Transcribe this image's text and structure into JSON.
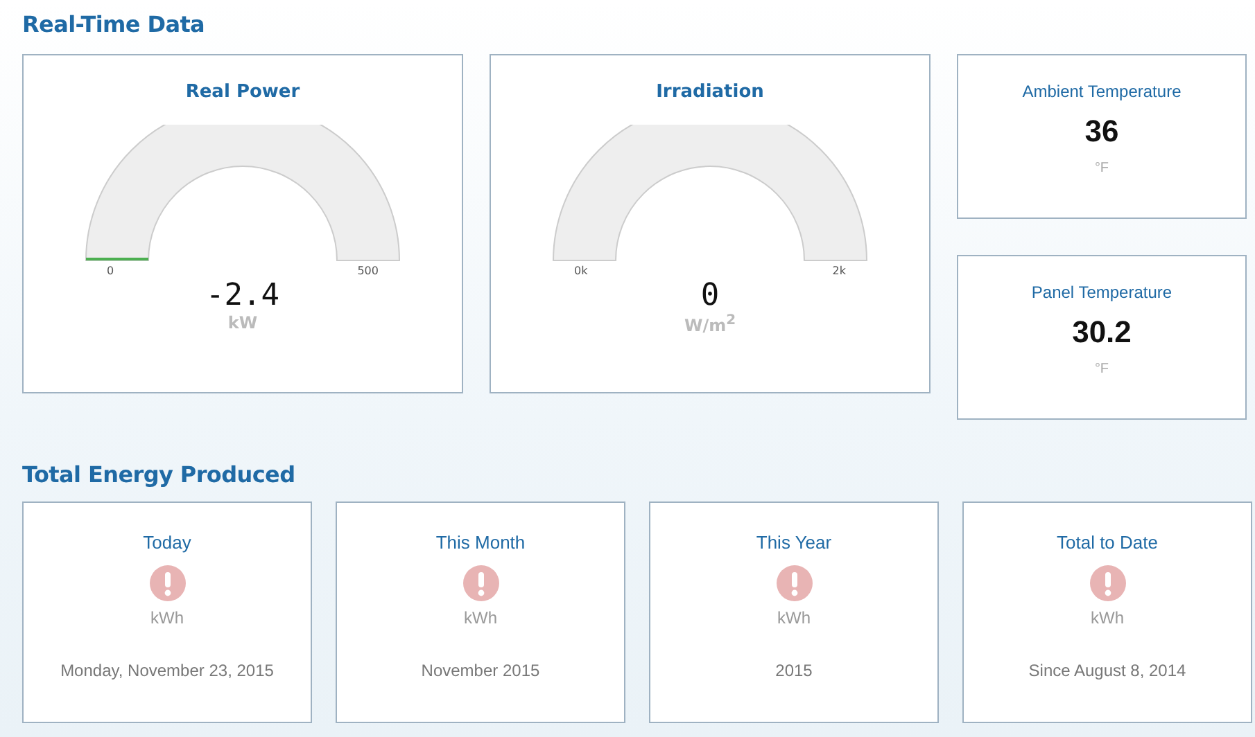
{
  "realtime": {
    "heading": "Real-Time Data",
    "gauges": [
      {
        "title": "Real Power",
        "min_label": "0",
        "max_label": "500",
        "value": "-2.4",
        "unit": "kW",
        "below_min": true
      },
      {
        "title": "Irradiation",
        "min_label": "0k",
        "max_label": "2k",
        "value": "0",
        "unit": "W/m$^{2}$",
        "below_min": false
      }
    ],
    "stats": [
      {
        "title": "Ambient Temperature",
        "value": "36",
        "unit": "°F"
      },
      {
        "title": "Panel Temperature",
        "value": "30.2",
        "unit": "°F"
      }
    ]
  },
  "energy": {
    "heading": "Total Energy Produced",
    "cards": [
      {
        "title": "Today",
        "alert": true,
        "unit": "kWh",
        "period": "Monday, November 23, 2015"
      },
      {
        "title": "This Month",
        "alert": true,
        "unit": "kWh",
        "period": "November 2015"
      },
      {
        "title": "This Year",
        "alert": true,
        "unit": "kWh",
        "period": "2015"
      },
      {
        "title": "Total to Date",
        "alert": true,
        "unit": "kWh",
        "period": "Since August 8, 2014"
      }
    ]
  }
}
